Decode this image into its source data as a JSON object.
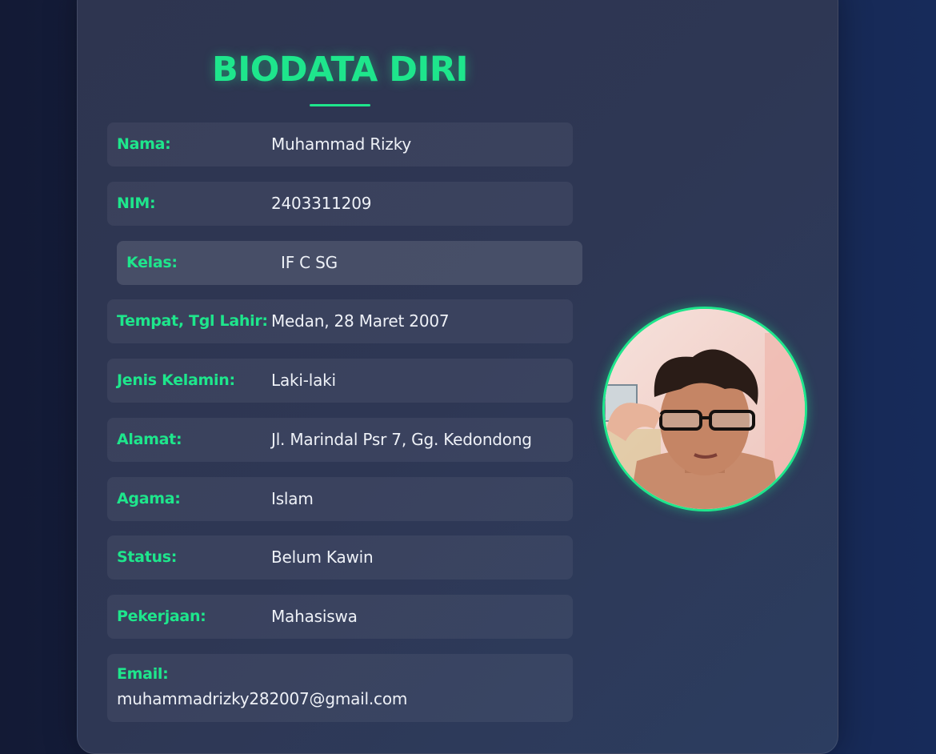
{
  "title": "BIODATA DIRI",
  "fields": [
    {
      "label": "Nama:",
      "value": "Muhammad Rizky"
    },
    {
      "label": "NIM:",
      "value": "2403311209"
    },
    {
      "label": "Kelas:",
      "value": "IF C SG"
    },
    {
      "label": "Tempat, Tgl Lahir:",
      "value": "Medan, 28 Maret 2007"
    },
    {
      "label": "Jenis Kelamin:",
      "value": "Laki-laki"
    },
    {
      "label": "Alamat:",
      "value": "Jl. Marindal Psr 7, Gg. Kedondong"
    },
    {
      "label": "Agama:",
      "value": "Islam"
    },
    {
      "label": "Status:",
      "value": "Belum Kawin"
    },
    {
      "label": "Pekerjaan:",
      "value": "Mahasiswa"
    },
    {
      "label": "Email:",
      "value": "muhammadrizky282007@gmail.com"
    }
  ],
  "colors": {
    "accent": "#1ee68c",
    "card": "#2e3550",
    "background": "#172348",
    "text": "#eef1f7"
  }
}
